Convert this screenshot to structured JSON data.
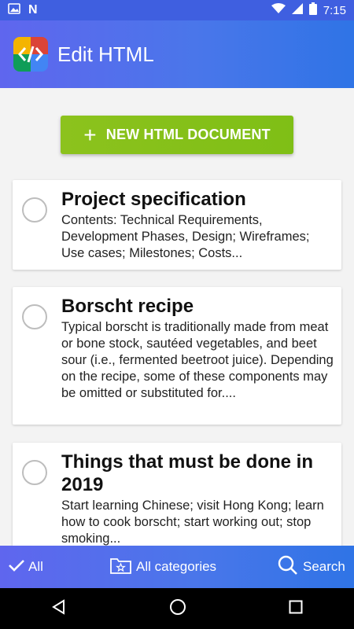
{
  "status_bar": {
    "time": "7:15"
  },
  "app_bar": {
    "title": "Edit HTML",
    "icon": "code-brackets-icon"
  },
  "new_button": {
    "label": "NEW HTML DOCUMENT"
  },
  "documents": [
    {
      "title": "Project specification",
      "description": "Contents: Technical Requirements, Development Phases, Design; Wireframes; Use cases; Milestones; Costs..."
    },
    {
      "title": "Borscht recipe",
      "description": "Typical borscht is traditionally made from meat or bone stock, sautéed vegetables, and beet sour (i.e., fermented beetroot juice). Depending on the recipe, some of these components may be omitted or substituted for...."
    },
    {
      "title": "Things that must be done in 2019",
      "description": "Start learning Chinese; visit Hong Kong; learn how to cook borscht; start working out; stop smoking..."
    }
  ],
  "bottom_bar": {
    "all_label": "All",
    "categories_label": "All categories",
    "search_label": "Search"
  },
  "colors": {
    "accent": "#4a76ea",
    "button": "#8cc21d"
  }
}
